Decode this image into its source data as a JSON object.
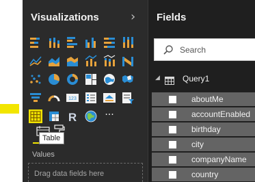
{
  "visualizations": {
    "title": "Visualizations",
    "collapse_glyph": "›",
    "icons": [
      [
        "stacked-bar-icon",
        "stacked-column-icon",
        "clustered-bar-icon",
        "clustered-column-icon",
        "100-stacked-bar-icon",
        "100-stacked-column-icon"
      ],
      [
        "line-chart-icon",
        "area-chart-icon",
        "stacked-area-icon",
        "line-column-icon",
        "line-stacked-column-icon",
        "ribbon-chart-icon"
      ],
      [
        "scatter-chart-icon",
        "pie-chart-icon",
        "donut-chart-icon",
        "treemap-icon",
        "map-icon",
        "filled-map-icon"
      ],
      [
        "funnel-icon",
        "gauge-icon",
        "card-icon",
        "multi-row-card-icon",
        "kpi-icon",
        "slicer-icon"
      ],
      [
        "table-icon",
        "matrix-icon",
        "r-script-icon",
        "globe-icon",
        "more-icon"
      ]
    ],
    "more_glyph": "···",
    "r_glyph": "R",
    "card_glyph": "123",
    "selected": "table-icon",
    "tooltip": "Table",
    "values_label": "Values",
    "drop_placeholder": "Drag data fields here"
  },
  "fields": {
    "title": "Fields",
    "search_placeholder": "Search",
    "table_name": "Query1",
    "items": [
      "aboutMe",
      "accountEnabled",
      "birthday",
      "city",
      "companyName",
      "country"
    ]
  },
  "colors": {
    "accent": "#f2e500",
    "viz_bg": "#2b2b2b",
    "fields_bg": "#1f1f1f",
    "field_row": "#646464",
    "blue": "#2a8dd4",
    "orange": "#e6a23c",
    "yellow": "#f2c811"
  }
}
